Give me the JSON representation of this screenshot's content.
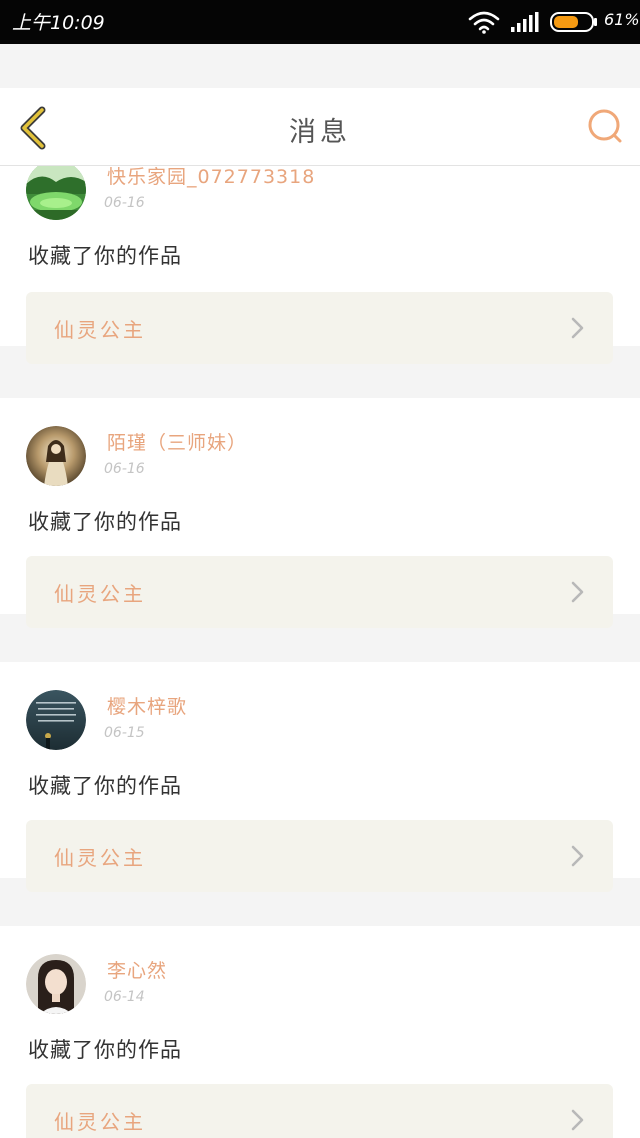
{
  "status_bar": {
    "time": "上午10:09",
    "battery_percent": "61%",
    "battery_level": 0.61,
    "icons": [
      "wifi-icon",
      "signal-icon",
      "battery-icon"
    ]
  },
  "header": {
    "title": "消息",
    "back_icon": "chevron-left-icon",
    "search_icon": "search-icon"
  },
  "colors": {
    "accent": "#e8a57e",
    "back_icon": "#e2c23a",
    "card_link_bg": "#f4f3ec",
    "page_bg": "#f4f4f4"
  },
  "messages": [
    {
      "username": "快乐家园_072773318",
      "date": "06-16",
      "action": "收藏了你的作品",
      "work_title": "仙灵公主",
      "avatar": "landscape-avatar"
    },
    {
      "username": "陌瑾（三师妹）",
      "date": "06-16",
      "action": "收藏了你的作品",
      "work_title": "仙灵公主",
      "avatar": "character-avatar"
    },
    {
      "username": "樱木梓歌",
      "date": "06-15",
      "action": "收藏了你的作品",
      "work_title": "仙灵公主",
      "avatar": "text-quote-avatar"
    },
    {
      "username": "李心然",
      "date": "06-14",
      "action": "收藏了你的作品",
      "work_title": "仙灵公主",
      "avatar": "portrait-avatar"
    }
  ]
}
